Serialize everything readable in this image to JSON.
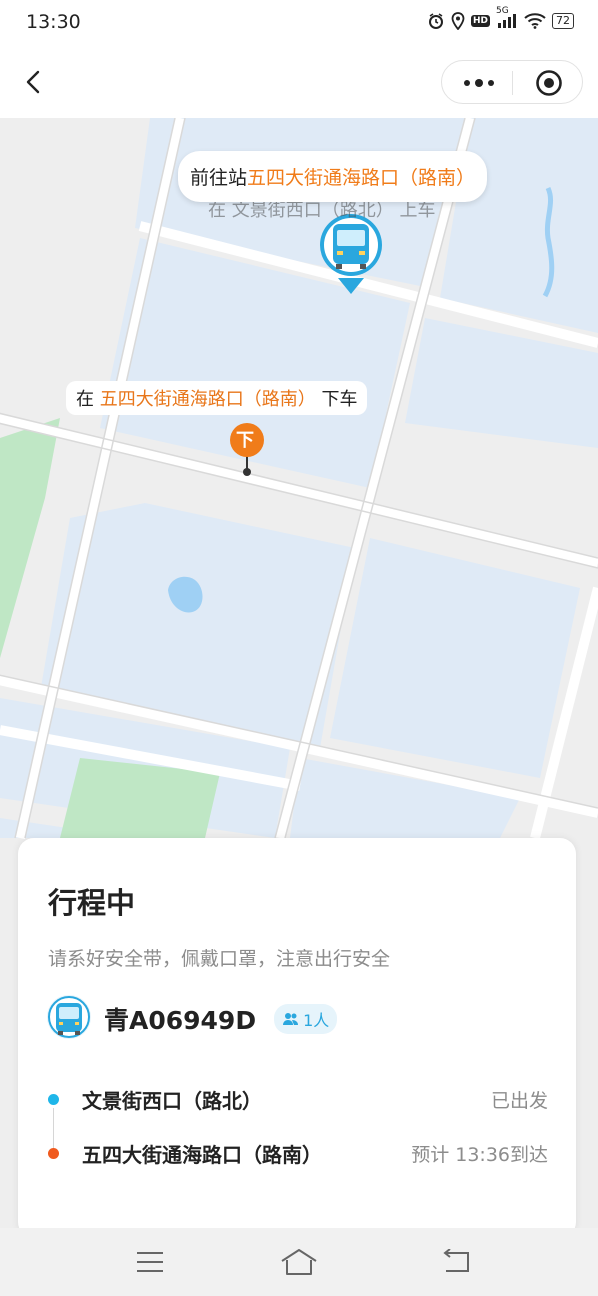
{
  "status_bar": {
    "time": "13:30",
    "network": "5G",
    "hd": "HD",
    "battery": "72"
  },
  "nav": {
    "back_icon": "chevron-left-icon",
    "more_icon": "more-dots-icon",
    "target_icon": "record-target-icon"
  },
  "map": {
    "board_label_parts": [
      "前往站",
      "五四大街通海路口（路南）"
    ],
    "partial_hidden_text": "在 文景街西口（路北） 上车",
    "alight_label_parts": [
      "在 ",
      "五四大街通海路口（路南）",
      " 下车"
    ],
    "alight_marker": "下",
    "colors": {
      "water": "#dfeaf6",
      "green": "#bfe7c5",
      "road": "#ffffff",
      "base": "#eeeeee",
      "orange": "#f07c1a",
      "bus_blue": "#2aa7de"
    }
  },
  "trip": {
    "title": "行程中",
    "tip": "请系好安全带，佩戴口罩，注意出行安全",
    "plate": "青A06949D",
    "passengers": "1人",
    "stops": [
      {
        "name": "文景街西口（路北）",
        "status": "已出发",
        "dot_color": "#1fb6e9"
      },
      {
        "name": "五四大街通海路口（路南）",
        "status": "预计 13:36到达",
        "dot_color": "#f05a1e"
      }
    ]
  },
  "bottom_nav": {
    "menu_icon": "menu-icon",
    "home_icon": "home-icon",
    "back_icon": "return-icon"
  }
}
